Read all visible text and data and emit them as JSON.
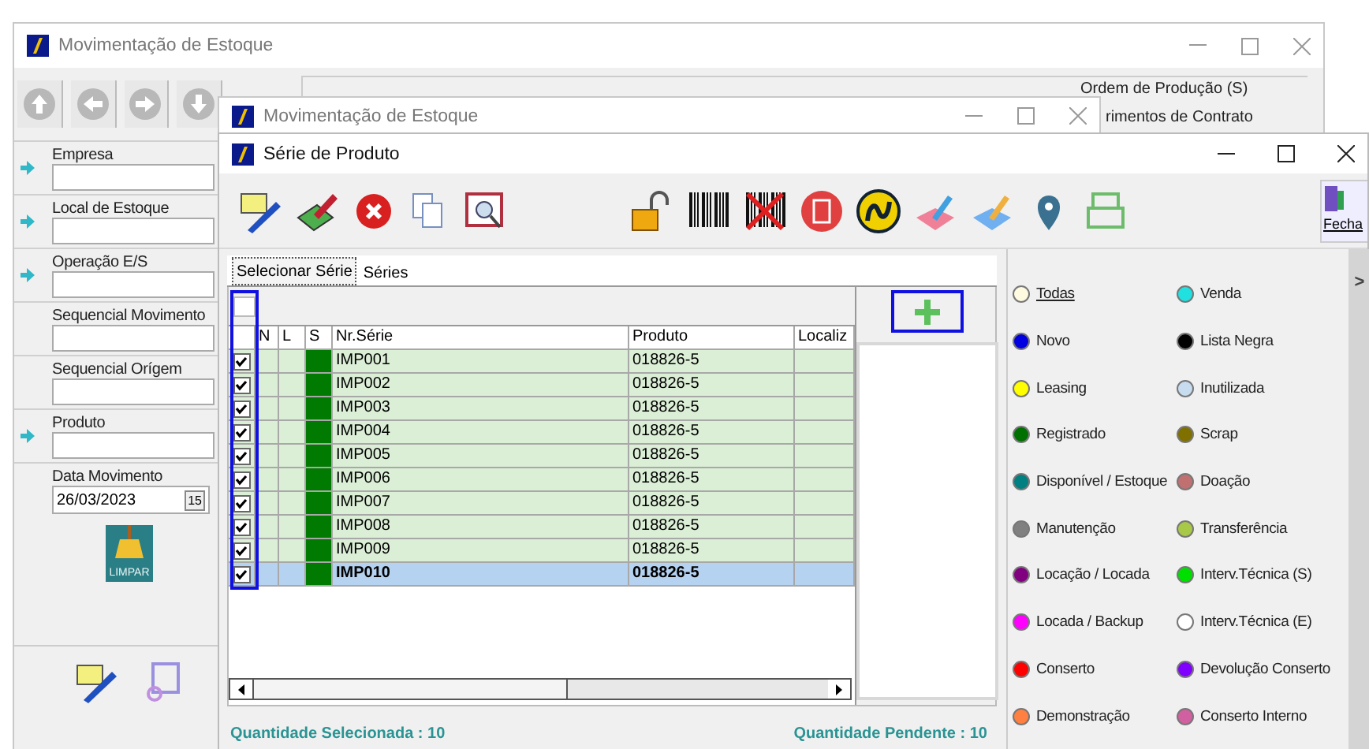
{
  "back_window": {
    "title": "Movimentação de Estoque",
    "radio_options": [
      {
        "label": "Ordem de Produção (S)"
      },
      {
        "label": "rimentos de Contrato"
      }
    ],
    "fields": [
      {
        "label": "Empresa",
        "lookup": true
      },
      {
        "label": "Local de Estoque",
        "lookup": true
      },
      {
        "label": "Operação E/S",
        "lookup": true
      },
      {
        "label": "Sequencial Movimento",
        "lookup": false
      },
      {
        "label": "Sequencial Orígem",
        "lookup": false
      },
      {
        "label": "Produto",
        "lookup": true
      }
    ],
    "date_field": {
      "label": "Data Movimento",
      "value": "26/03/2023",
      "calendar": "15"
    },
    "clear_button": "LIMPAR"
  },
  "middle_window": {
    "title": "Movimentação de Estoque"
  },
  "dialog": {
    "title": "Série de Produto",
    "close_button": "Fecha",
    "tabs": [
      {
        "label": "Selecionar Série",
        "selected": true
      },
      {
        "label": "Séries",
        "selected": false
      }
    ],
    "filter_row": {
      "checked": false
    },
    "grid": {
      "columns": [
        "N",
        "L",
        "S",
        "Nr.Série",
        "Produto",
        "Localiz"
      ],
      "rows": [
        {
          "serie": "IMP001",
          "produto": "018826-5",
          "checked": true,
          "selected": false,
          "color": "#007a00"
        },
        {
          "serie": "IMP002",
          "produto": "018826-5",
          "checked": true,
          "selected": false,
          "color": "#007a00"
        },
        {
          "serie": "IMP003",
          "produto": "018826-5",
          "checked": true,
          "selected": false,
          "color": "#007a00"
        },
        {
          "serie": "IMP004",
          "produto": "018826-5",
          "checked": true,
          "selected": false,
          "color": "#007a00"
        },
        {
          "serie": "IMP005",
          "produto": "018826-5",
          "checked": true,
          "selected": false,
          "color": "#007a00"
        },
        {
          "serie": "IMP006",
          "produto": "018826-5",
          "checked": true,
          "selected": false,
          "color": "#007a00"
        },
        {
          "serie": "IMP007",
          "produto": "018826-5",
          "checked": true,
          "selected": false,
          "color": "#007a00"
        },
        {
          "serie": "IMP008",
          "produto": "018826-5",
          "checked": true,
          "selected": false,
          "color": "#007a00"
        },
        {
          "serie": "IMP009",
          "produto": "018826-5",
          "checked": true,
          "selected": false,
          "color": "#007a00"
        },
        {
          "serie": "IMP010",
          "produto": "018826-5",
          "checked": true,
          "selected": true,
          "color": "#007a00"
        }
      ]
    },
    "legend": [
      {
        "label": "Todas",
        "color": "#fffbe0",
        "selected": true
      },
      {
        "label": "Venda",
        "color": "#20e0e0",
        "selected": false
      },
      {
        "label": "Novo",
        "color": "#0000e0",
        "selected": false
      },
      {
        "label": "Lista Negra",
        "color": "#000000",
        "selected": false
      },
      {
        "label": "Leasing",
        "color": "#ffff00",
        "selected": false
      },
      {
        "label": "Inutilizada",
        "color": "#c8dcf0",
        "selected": false
      },
      {
        "label": "Registrado",
        "color": "#007000",
        "selected": false
      },
      {
        "label": "Scrap",
        "color": "#807000",
        "selected": false
      },
      {
        "label": "Disponível / Estoque",
        "color": "#008080",
        "selected": false
      },
      {
        "label": "Doação",
        "color": "#c07070",
        "selected": false
      },
      {
        "label": "Manutenção",
        "color": "#808080",
        "selected": false
      },
      {
        "label": "Transferência",
        "color": "#a8c848",
        "selected": false
      },
      {
        "label": "Locação / Locada",
        "color": "#800080",
        "selected": false
      },
      {
        "label": "Interv.Técnica (S)",
        "color": "#00e000",
        "selected": false
      },
      {
        "label": "Locada / Backup",
        "color": "#ff00ff",
        "selected": false
      },
      {
        "label": "Interv.Técnica (E)",
        "color": "#ffffff",
        "selected": false
      },
      {
        "label": "Conserto",
        "color": "#ff0000",
        "selected": false
      },
      {
        "label": "Devolução Conserto",
        "color": "#8000ff",
        "selected": false
      },
      {
        "label": "Demonstração",
        "color": "#ff8040",
        "selected": false
      },
      {
        "label": "Conserto Interno",
        "color": "#d060a0",
        "selected": false
      }
    ],
    "footer": {
      "selected": "Quantidade Selecionada :  10",
      "pending": "Quantidade Pendente : 10"
    },
    "panel_toggle": ">"
  }
}
